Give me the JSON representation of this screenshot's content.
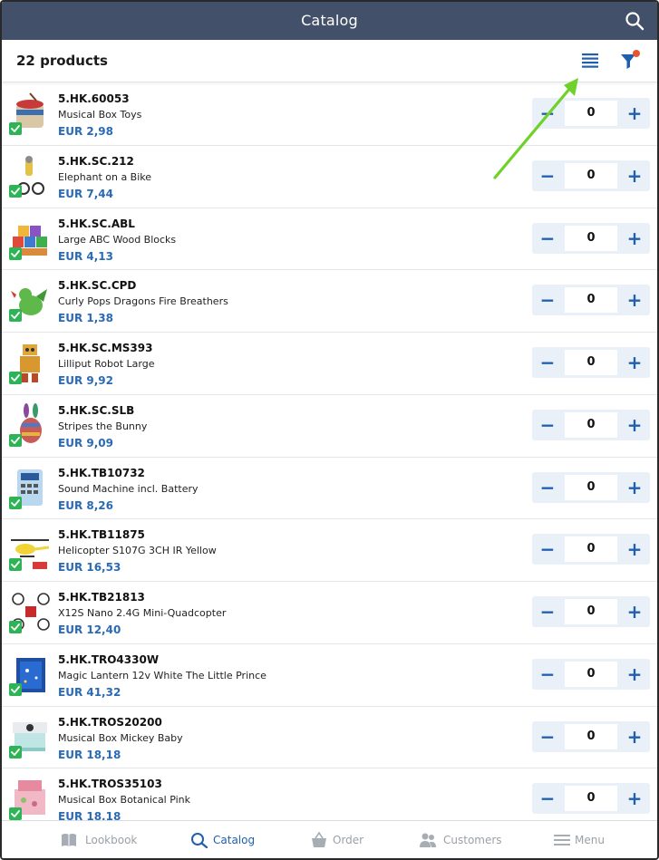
{
  "app": {
    "title": "Catalog"
  },
  "subheader": {
    "count_label": "22 products"
  },
  "colors": {
    "header_bg": "#435069",
    "accent": "#1f5fae",
    "price": "#2a6ab5",
    "check": "#2fb357",
    "filter_dot": "#e8542d",
    "arrow": "#6fd12a"
  },
  "products": [
    {
      "sku": "5.HK.60053",
      "name": "Musical Box Toys",
      "price": "EUR 2,98",
      "qty": "0",
      "icon": "toy-drum"
    },
    {
      "sku": "5.HK.SC.212",
      "name": "Elephant on a Bike",
      "price": "EUR 7,44",
      "qty": "0",
      "icon": "toy-elephant-bike"
    },
    {
      "sku": "5.HK.SC.ABL",
      "name": "Large ABC Wood Blocks",
      "price": "EUR 4,13",
      "qty": "0",
      "icon": "toy-blocks"
    },
    {
      "sku": "5.HK.SC.CPD",
      "name": "Curly Pops Dragons Fire Breathers",
      "price": "EUR 1,38",
      "qty": "0",
      "icon": "toy-dragon"
    },
    {
      "sku": "5.HK.SC.MS393",
      "name": "Lilliput Robot Large",
      "price": "EUR 9,92",
      "qty": "0",
      "icon": "toy-robot"
    },
    {
      "sku": "5.HK.SC.SLB",
      "name": "Stripes the Bunny",
      "price": "EUR 9,09",
      "qty": "0",
      "icon": "toy-bunny"
    },
    {
      "sku": "5.HK.TB10732",
      "name": "Sound Machine incl. Battery",
      "price": "EUR 8,26",
      "qty": "0",
      "icon": "toy-sound-machine"
    },
    {
      "sku": "5.HK.TB11875",
      "name": "Helicopter S107G 3CH IR Yellow",
      "price": "EUR 16,53",
      "qty": "0",
      "icon": "toy-helicopter"
    },
    {
      "sku": "5.HK.TB21813",
      "name": "X12S Nano 2.4G Mini-Quadcopter",
      "price": "EUR 12,40",
      "qty": "0",
      "icon": "toy-quadcopter"
    },
    {
      "sku": "5.HK.TRO4330W",
      "name": "Magic Lantern 12v White The Little Prince",
      "price": "EUR 41,32",
      "qty": "0",
      "icon": "toy-lantern"
    },
    {
      "sku": "5.HK.TROS20200",
      "name": "Musical Box Mickey Baby",
      "price": "EUR 18,18",
      "qty": "0",
      "icon": "toy-music-box"
    },
    {
      "sku": "5.HK.TROS35103",
      "name": "Musical Box Botanical Pink",
      "price": "EUR 18,18",
      "qty": "0",
      "icon": "toy-music-box-pink"
    }
  ],
  "tabs": [
    {
      "label": "Lookbook",
      "icon": "book-icon",
      "active": false
    },
    {
      "label": "Catalog",
      "icon": "search-icon",
      "active": true
    },
    {
      "label": "Order",
      "icon": "basket-icon",
      "active": false
    },
    {
      "label": "Customers",
      "icon": "people-icon",
      "active": false
    },
    {
      "label": "Menu",
      "icon": "menu-icon",
      "active": false
    }
  ]
}
